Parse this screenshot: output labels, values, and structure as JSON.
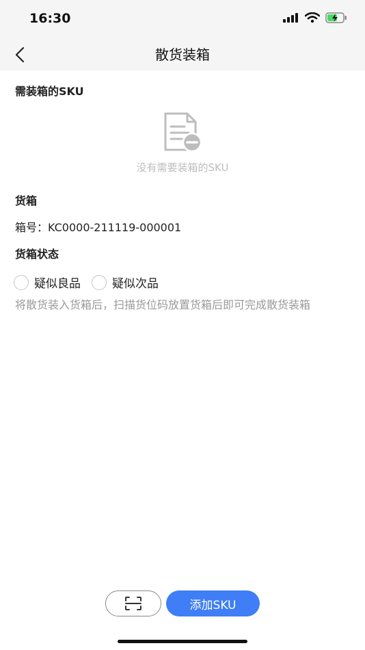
{
  "status_bar": {
    "time": "16:30",
    "icons": [
      "signal-icon",
      "wifi-icon",
      "battery-charging-icon"
    ]
  },
  "nav": {
    "title": "散货装箱",
    "back_icon": "chevron-left-icon"
  },
  "sku_section": {
    "title": "需装箱的SKU",
    "empty_icon": "document-minus-icon",
    "empty_text": "没有需要装箱的SKU"
  },
  "box_section": {
    "title": "货箱",
    "box_no": "箱号：KC0000-211119-000001"
  },
  "status_section": {
    "title": "货箱状态",
    "options": [
      "疑似良品",
      "疑似次品"
    ],
    "hint": "将散货装入货箱后，扫描货位码放置货箱后即可完成散货装箱"
  },
  "actions": {
    "scan_icon": "scan-icon",
    "add_label": "添加SKU",
    "accent_color": "#3f7ef6"
  }
}
